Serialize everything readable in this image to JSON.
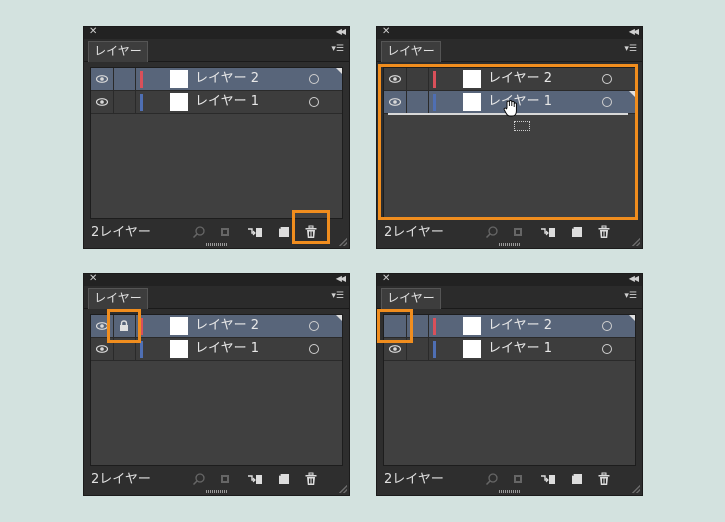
{
  "panels": [
    {
      "id": "top-left",
      "tab": "レイヤー",
      "count": "2レイヤー",
      "layers": [
        {
          "name": "レイヤー 2",
          "color": "#d9505a",
          "selected": true,
          "eye": true,
          "lock": false
        },
        {
          "name": "レイヤー 1",
          "color": "#4f6fb3",
          "selected": false,
          "eye": true,
          "lock": false
        }
      ]
    },
    {
      "id": "top-right",
      "tab": "レイヤー",
      "count": "2レイヤー",
      "layers": [
        {
          "name": "レイヤー 2",
          "color": "#d9505a",
          "selected": false,
          "eye": true,
          "lock": false
        },
        {
          "name": "レイヤー 1",
          "color": "#4f6fb3",
          "selected": true,
          "eye": true,
          "lock": false
        }
      ]
    },
    {
      "id": "bottom-left",
      "tab": "レイヤー",
      "count": "2レイヤー",
      "layers": [
        {
          "name": "レイヤー 2",
          "color": "#d9505a",
          "selected": true,
          "eye": true,
          "lock": true
        },
        {
          "name": "レイヤー 1",
          "color": "#4f6fb3",
          "selected": false,
          "eye": true,
          "lock": false
        }
      ]
    },
    {
      "id": "bottom-right",
      "tab": "レイヤー",
      "count": "2レイヤー",
      "layers": [
        {
          "name": "レイヤー 2",
          "color": "#d9505a",
          "selected": true,
          "eye": false,
          "lock": false
        },
        {
          "name": "レイヤー 1",
          "color": "#4f6fb3",
          "selected": false,
          "eye": true,
          "lock": false
        }
      ]
    }
  ],
  "icons": {
    "footer": [
      "search-icon",
      "clipping-mask-icon",
      "new-sublayer-icon",
      "new-layer-icon",
      "trash-icon"
    ],
    "row": [
      "eye-icon",
      "lock-icon",
      "target-icon"
    ],
    "header": [
      "close-icon",
      "collapse-icon",
      "panel-menu-icon"
    ]
  },
  "colors": {
    "highlight": "#f08d1e",
    "selected_row": "#58657a",
    "background": "#d3e2df"
  }
}
